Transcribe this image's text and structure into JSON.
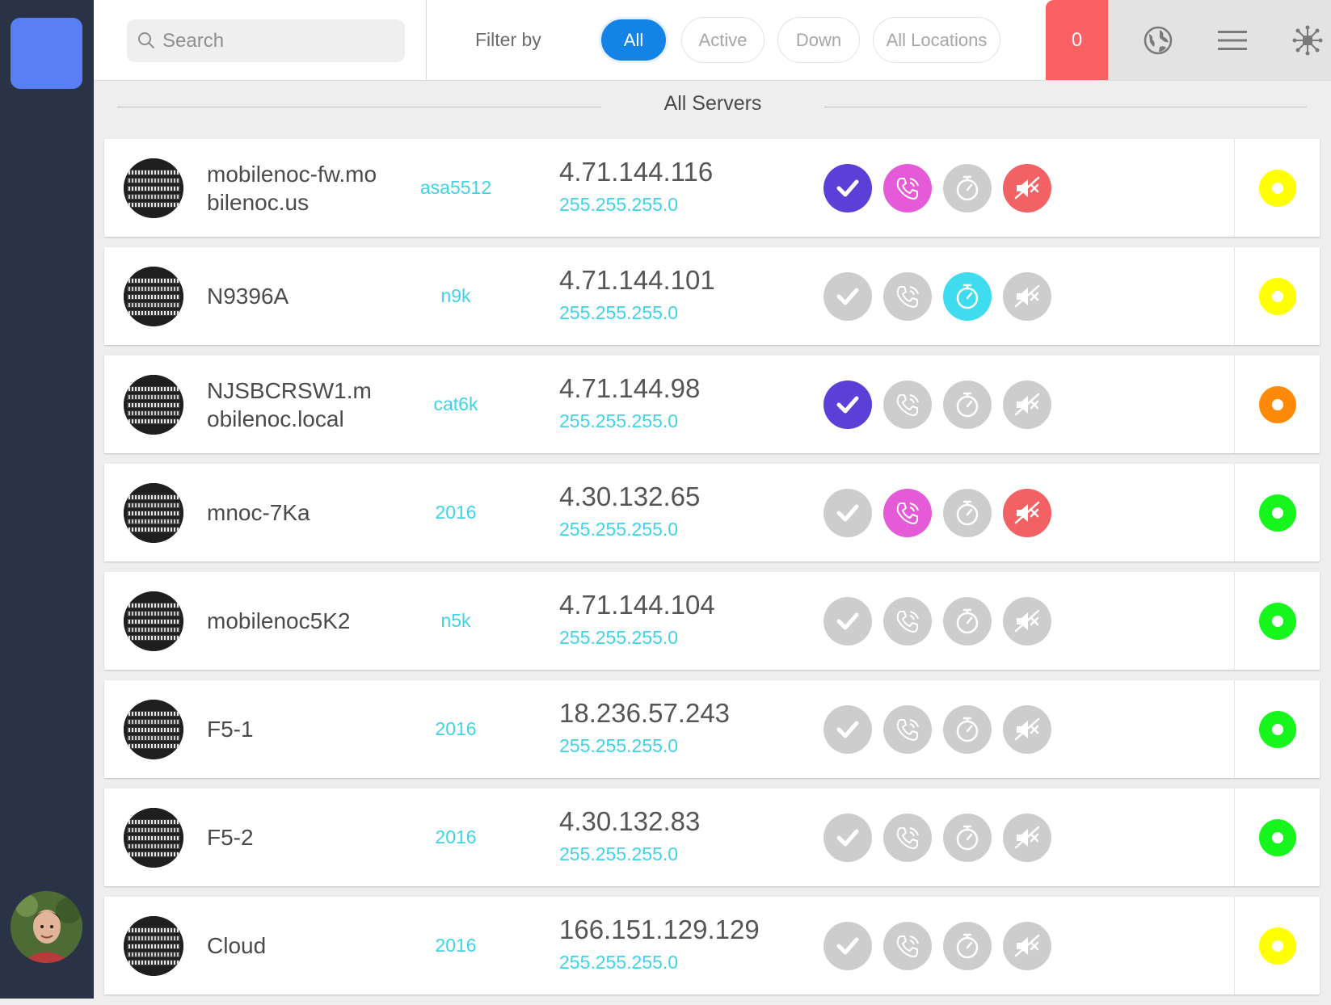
{
  "search": {
    "placeholder": "Search"
  },
  "filter": {
    "label": "Filter by",
    "options": [
      {
        "label": "All",
        "active": true
      },
      {
        "label": "Active",
        "active": false
      },
      {
        "label": "Down",
        "active": false
      },
      {
        "label": "All Locations",
        "active": false
      }
    ]
  },
  "alerts": {
    "count": "0"
  },
  "tools": [
    "globe-icon",
    "menu-icon",
    "network-icon"
  ],
  "section": {
    "title": "All Servers"
  },
  "colors": {
    "check_on": "#5b3fd6",
    "call_on": "#e55ad6",
    "timer_on": "#3fdcf0",
    "mute_on": "#f26163",
    "inactive": "#cdcdcd",
    "status_yellow": "#ffff00",
    "status_orange": "#ff8a0a",
    "status_green": "#16f51c"
  },
  "servers": [
    {
      "name": "mobilenoc-fw.mobilenoc.us",
      "model": "asa5512",
      "ip": "4.71.144.116",
      "mask": "255.255.255.0",
      "check": true,
      "call": true,
      "timer": false,
      "mute": true,
      "status": "yellow"
    },
    {
      "name": "N9396A",
      "model": "n9k",
      "ip": "4.71.144.101",
      "mask": "255.255.255.0",
      "check": false,
      "call": false,
      "timer": true,
      "mute": false,
      "status": "yellow"
    },
    {
      "name": "NJSBCRSW1.mobilenoc.local",
      "model": "cat6k",
      "ip": "4.71.144.98",
      "mask": "255.255.255.0",
      "check": true,
      "call": false,
      "timer": false,
      "mute": false,
      "status": "orange"
    },
    {
      "name": "mnoc-7Ka",
      "model": "2016",
      "ip": "4.30.132.65",
      "mask": "255.255.255.0",
      "check": false,
      "call": true,
      "timer": false,
      "mute": true,
      "status": "green"
    },
    {
      "name": "mobilenoc5K2",
      "model": "n5k",
      "ip": "4.71.144.104",
      "mask": "255.255.255.0",
      "check": false,
      "call": false,
      "timer": false,
      "mute": false,
      "status": "green"
    },
    {
      "name": "F5-1",
      "model": "2016",
      "ip": "18.236.57.243",
      "mask": "255.255.255.0",
      "check": false,
      "call": false,
      "timer": false,
      "mute": false,
      "status": "green"
    },
    {
      "name": "F5-2",
      "model": "2016",
      "ip": "4.30.132.83",
      "mask": "255.255.255.0",
      "check": false,
      "call": false,
      "timer": false,
      "mute": false,
      "status": "green"
    },
    {
      "name": "Cloud",
      "model": "2016",
      "ip": "166.151.129.129",
      "mask": "255.255.255.0",
      "check": false,
      "call": false,
      "timer": false,
      "mute": false,
      "status": "yellow"
    }
  ]
}
